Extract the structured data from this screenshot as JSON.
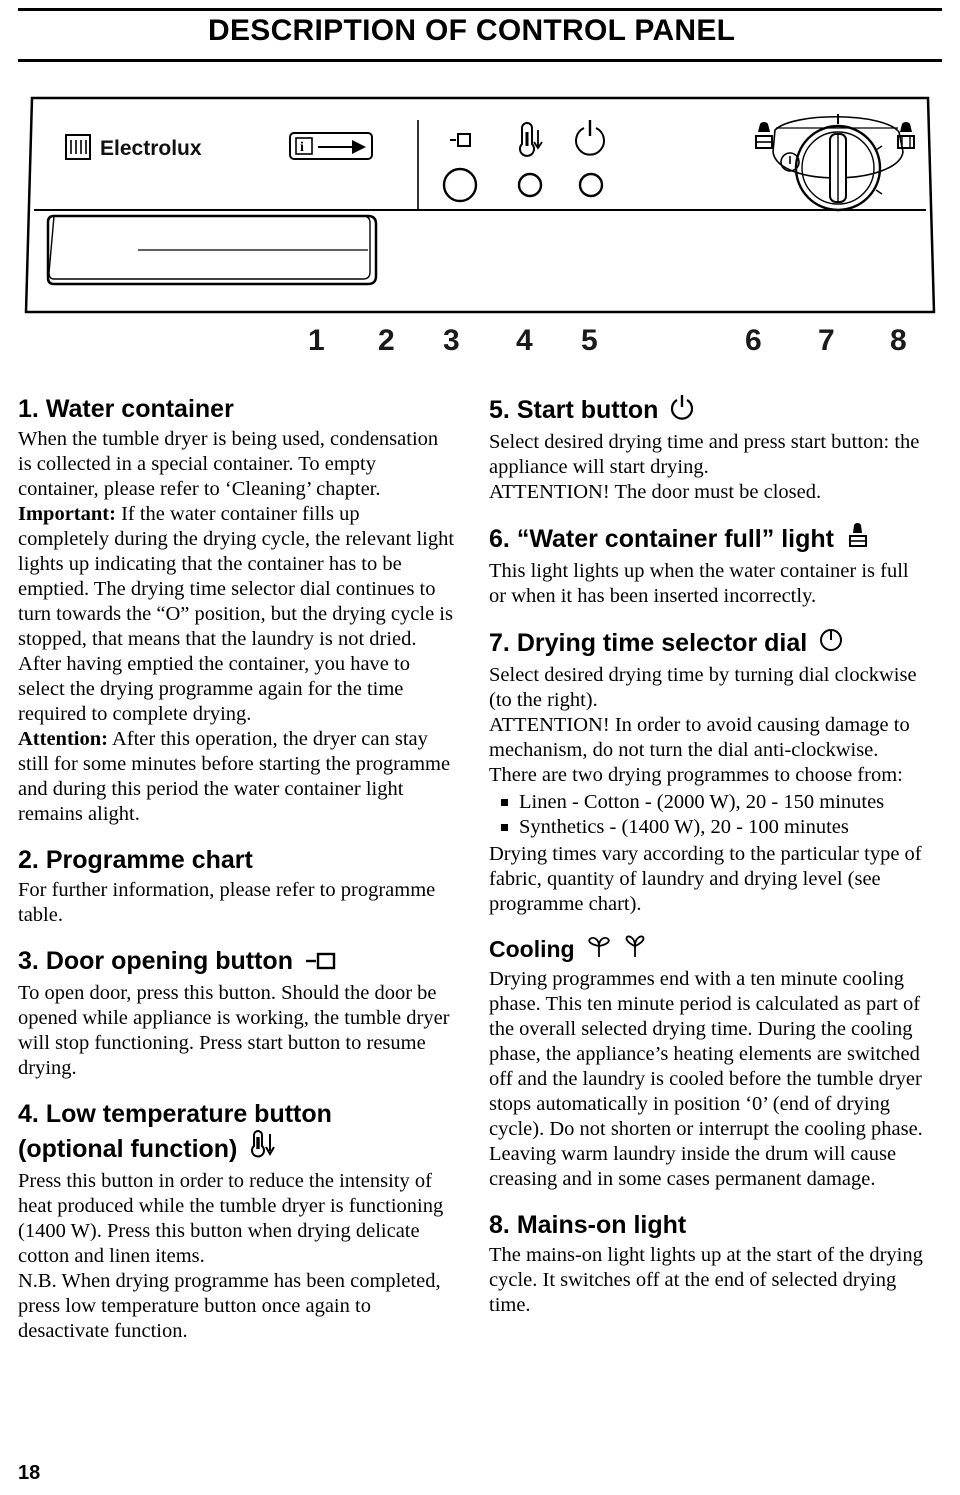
{
  "header": {
    "title": "DESCRIPTION OF CONTROL PANEL"
  },
  "illustration": {
    "brand": "Electrolux",
    "callout_numbers": [
      "1",
      "2",
      "3",
      "4",
      "5",
      "6",
      "7",
      "8"
    ],
    "icons": [
      {
        "name": "programme-chart-icon",
        "label": "i"
      },
      {
        "name": "door-opening-icon",
        "label": ""
      },
      {
        "name": "low-temperature-icon",
        "label": ""
      },
      {
        "name": "start-button-icon",
        "label": ""
      },
      {
        "name": "water-container-full-icon",
        "label": ""
      },
      {
        "name": "drying-time-selector-dial",
        "label": ""
      },
      {
        "name": "mains-on-light-icon",
        "label": ""
      }
    ]
  },
  "left_column": {
    "item1": {
      "number": "1.",
      "title": "Water container",
      "p1": "When the tumble dryer is being used, condensation is collected in a special container. To empty container, please refer to ‘Cleaning’ chapter.",
      "p2_bold": "Important:",
      "p2": " If the water container fills up completely during the drying cycle, the relevant light lights up indicating that the container has to be emptied. The drying time selector dial continues to turn towards the “O” position, but the drying cycle is stopped, that means that the laundry is not dried. After having emptied the container, you have to select the drying programme again for the time required to complete drying.",
      "p3_bold": "Attention:",
      "p3": " After this operation, the dryer can stay still for some minutes before starting the programme and during this period the water container light remains alight."
    },
    "item2": {
      "number": "2.",
      "title": "Programme chart",
      "p1": "For further information, please refer to programme table."
    },
    "item3": {
      "number": "3.",
      "title": "Door opening button",
      "p1": "To open door, press this button. Should the door be opened while appliance is working, the tumble dryer will stop functioning. Press start button to resume drying."
    },
    "item4": {
      "number": "4.",
      "title": "Low temperature button",
      "title_line2": "(optional function)",
      "p1": "Press this button in order to reduce the intensity of heat produced while the tumble dryer is functioning (1400 W). Press this button when drying delicate cotton and linen items.",
      "p2": "N.B. When drying programme has been completed, press low temperature button once again to desactivate function."
    }
  },
  "right_column": {
    "item5": {
      "number": "5.",
      "title": "Start button",
      "p1": "Select desired drying time and press start button: the appliance will start drying.",
      "p2": "ATTENTION! The door must be closed."
    },
    "item6": {
      "number": "6.",
      "title": "“Water container full” light",
      "p1": "This light lights up when the water container is full or when it has been inserted incorrectly."
    },
    "item7": {
      "number": "7.",
      "title": "Drying time selector dial",
      "p1": "Select desired drying time by turning dial clockwise (to the right).",
      "p2": "ATTENTION! In order to avoid causing damage to mechanism, do not turn the dial anti-clockwise.",
      "p3": "There are two drying programmes to choose from:",
      "bullets": [
        "Linen - Cotton - (2000 W), 20 - 150 minutes",
        "Synthetics - (1400 W), 20 - 100 minutes"
      ],
      "p4": "Drying times vary according to the particular type of fabric, quantity of laundry and drying level (see programme chart)."
    },
    "cooling": {
      "title": "Cooling",
      "p1": "Drying programmes end with a ten minute cooling phase. This ten minute period is calculated as part of the overall selected drying time. During the cooling phase, the appliance’s heating elements are switched off and the laundry is cooled before the tumble dryer stops automatically in position ‘0’ (end of drying cycle). Do not shorten or interrupt the cooling phase. Leaving warm laundry inside the drum will cause creasing and in some cases permanent damage."
    },
    "item8": {
      "number": "8.",
      "title": "Mains-on light",
      "p1": "The mains-on light lights up at the start of the drying cycle. It switches off at the end of selected drying time."
    }
  },
  "footer": {
    "page_number": "18"
  }
}
